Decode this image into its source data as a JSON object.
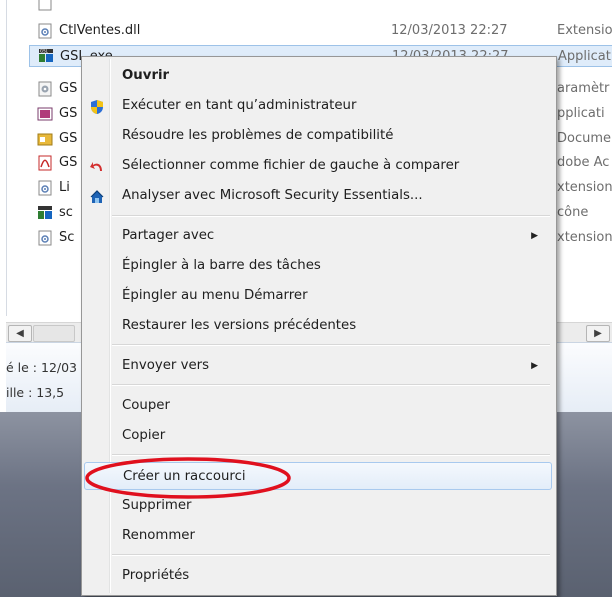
{
  "explorer": {
    "files": [
      {
        "name": "CtlVentes.dll",
        "date": "12/03/2013 22:27",
        "type": "Extension",
        "icon": "dll-file-icon"
      },
      {
        "name": "GSL.exe",
        "date": "12/03/2013 22:27",
        "type": "Applicati",
        "icon": "exe-file-icon"
      },
      {
        "name": "GS",
        "date": "",
        "type": "aramètr",
        "icon": "config-file-icon"
      },
      {
        "name": "GS",
        "date": "",
        "type": "pplicati",
        "icon": "app-file-icon"
      },
      {
        "name": "GS",
        "date": "",
        "type": "Documer",
        "icon": "document-file-icon"
      },
      {
        "name": "GS",
        "date": "",
        "type": "dobe Ac",
        "icon": "pdf-file-icon"
      },
      {
        "name": "Li",
        "date": "",
        "type": "xtension",
        "icon": "dll-file-icon"
      },
      {
        "name": "sc",
        "date": "",
        "type": "cône",
        "icon": "exe-file-icon"
      },
      {
        "name": "Sc",
        "date": "",
        "type": "xtension",
        "icon": "dll-file-icon"
      }
    ],
    "details": {
      "modified": "é le : 12/03",
      "size": "ille : 13,5"
    },
    "scroll_left": "◀",
    "scroll_right": "▶"
  },
  "context_menu": {
    "items": [
      {
        "label": "Ouvrir",
        "bold": true
      },
      {
        "label": "Exécuter en tant qu’administrateur",
        "icon": "uac-shield-icon"
      },
      {
        "label": "Résoudre les problèmes de compatibilité"
      },
      {
        "label": "Sélectionner comme fichier de gauche à comparer",
        "icon": "compare-arrow-icon"
      },
      {
        "label": "Analyser avec Microsoft Security Essentials...",
        "icon": "security-essentials-icon"
      },
      {
        "label": "Partager avec",
        "submenu": true
      },
      {
        "label": "Épingler à la barre des tâches"
      },
      {
        "label": "Épingler au menu Démarrer"
      },
      {
        "label": "Restaurer les versions précédentes"
      },
      {
        "label": "Envoyer vers",
        "submenu": true
      },
      {
        "label": "Couper"
      },
      {
        "label": "Copier"
      },
      {
        "label": "Créer un raccourci",
        "highlighted": true
      },
      {
        "label": "Supprimer"
      },
      {
        "label": "Renommer"
      },
      {
        "label": "Propriétés"
      }
    ],
    "submenu_arrow": "▶"
  },
  "annotation": {
    "color": "#e0101e"
  }
}
